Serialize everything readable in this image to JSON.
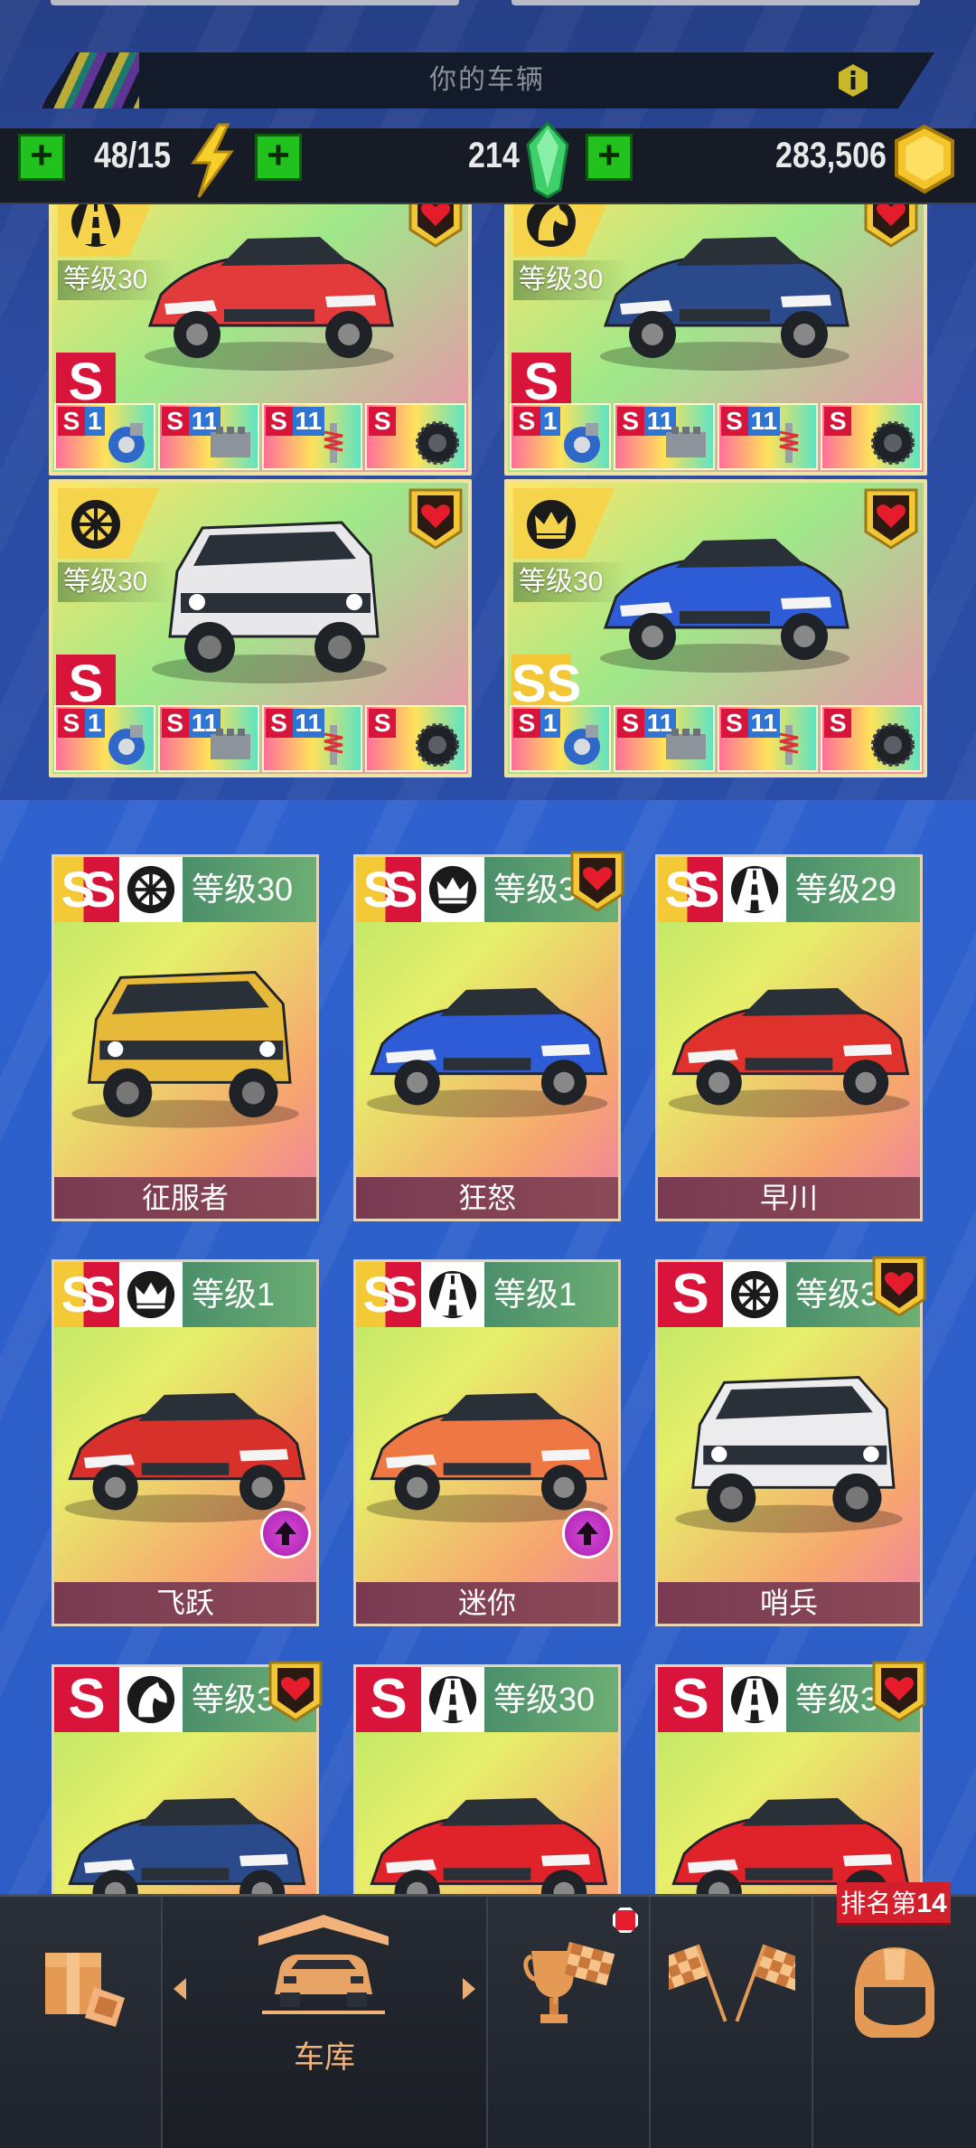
{
  "header": {
    "title": "你的车辆"
  },
  "resources": {
    "energy": "48/15",
    "gems": "214",
    "coins": "283,506"
  },
  "owned_cars": [
    {
      "level": "等级30",
      "rank": "S",
      "body_color": "#e33b3c",
      "class_icon": "road-icon",
      "favorite": true
    },
    {
      "level": "等级30",
      "rank": "S",
      "body_color": "#2b4a8c",
      "class_icon": "horse-icon",
      "favorite": true
    },
    {
      "level": "等级30",
      "rank": "S",
      "body_color": "#e8e8ea",
      "class_icon": "wheel-icon",
      "favorite": true
    },
    {
      "level": "等级30",
      "rank": "SS",
      "body_color": "#2e5bd6",
      "class_icon": "crown-icon",
      "favorite": true
    }
  ],
  "parts": [
    {
      "rank": "S",
      "level": "1",
      "icon": "turbo-icon"
    },
    {
      "rank": "S",
      "level": "11",
      "icon": "engine-icon"
    },
    {
      "rank": "S",
      "level": "11",
      "icon": "suspension-icon"
    },
    {
      "rank": "S",
      "level": "",
      "icon": "tire-icon"
    }
  ],
  "garage": [
    {
      "rank": "SS",
      "class_icon": "wheel-icon",
      "level": "等级30",
      "name": "征服者",
      "color": "#e6b93a",
      "favorite": false,
      "upgrade": false
    },
    {
      "rank": "SS",
      "class_icon": "crown-icon",
      "level": "等级3",
      "name": "狂怒",
      "color": "#2e5bd6",
      "favorite": true,
      "upgrade": false
    },
    {
      "rank": "SS",
      "class_icon": "road-icon",
      "level": "等级29",
      "name": "早川",
      "color": "#e0322c",
      "favorite": false,
      "upgrade": false
    },
    {
      "rank": "SS",
      "class_icon": "crown-icon",
      "level": "等级1",
      "name": "飞跃",
      "color": "#d8302a",
      "favorite": false,
      "upgrade": true
    },
    {
      "rank": "SS",
      "class_icon": "road-icon",
      "level": "等级1",
      "name": "迷你",
      "color": "#ef7744",
      "favorite": false,
      "upgrade": true
    },
    {
      "rank": "S",
      "class_icon": "wheel-icon",
      "level": "等级3",
      "name": "哨兵",
      "color": "#ececee",
      "favorite": true,
      "upgrade": false
    },
    {
      "rank": "S",
      "class_icon": "horse-icon",
      "level": "等级3",
      "name": "",
      "color": "#2b4a8c",
      "favorite": true,
      "upgrade": false
    },
    {
      "rank": "S",
      "class_icon": "road-icon",
      "level": "等级30",
      "name": "",
      "color": "#e0222a",
      "favorite": false,
      "upgrade": false
    },
    {
      "rank": "S",
      "class_icon": "road-icon",
      "level": "等级3",
      "name": "",
      "color": "#e0222a",
      "favorite": true,
      "upgrade": false
    }
  ],
  "nav": {
    "garage_label": "车库",
    "rank_prefix": "排名第",
    "rank_number": "14"
  },
  "colors": {
    "accent_green": "#22c21e",
    "rank_red": "#d9143a",
    "rank_gold": "#f2c634",
    "nav_orange": "#e8ae74"
  }
}
